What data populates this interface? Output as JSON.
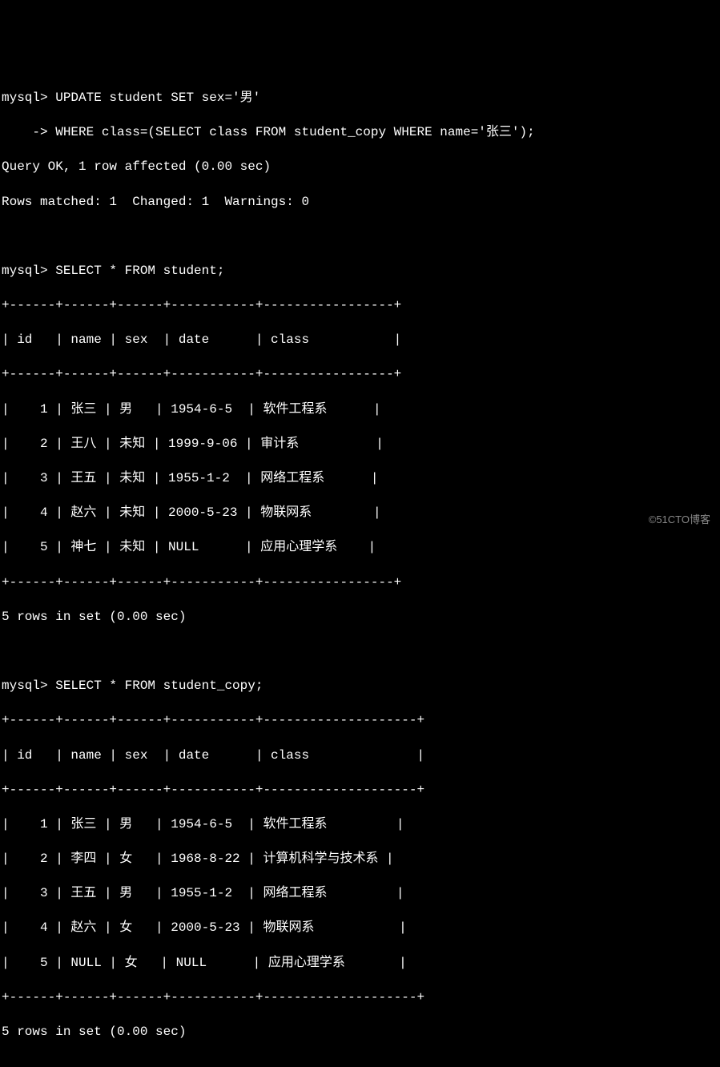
{
  "prompt": "mysql>",
  "continuation": "    ->",
  "commands": {
    "update_line1": " UPDATE student SET sex='男'",
    "update_line2": " WHERE class=(SELECT class FROM student_copy WHERE name='张三');",
    "select_student": " SELECT * FROM student;",
    "select_student_copy": " SELECT * FROM student_copy;"
  },
  "result": {
    "query_ok": "Query OK, 1 row affected (0.00 sec)",
    "rows_matched": "Rows matched: 1  Changed: 1  Warnings: 0",
    "rows_in_set": "5 rows in set (0.00 sec)"
  },
  "table1": {
    "border_top": "+------+------+------+-----------+-----------------+",
    "header": "| id   | name | sex  | date      | class           |",
    "border_mid": "+------+------+------+-----------+-----------------+",
    "rows": [
      "|    1 | 张三 | 男   | 1954-6-5  | 软件工程系      |",
      "|    2 | 王八 | 未知 | 1999-9-06 | 审计系          |",
      "|    3 | 王五 | 未知 | 1955-1-2  | 网络工程系      |",
      "|    4 | 赵六 | 未知 | 2000-5-23 | 物联网系        |",
      "|    5 | 神七 | 未知 | NULL      | 应用心理学系    |"
    ],
    "border_bot": "+------+------+------+-----------+-----------------+"
  },
  "table2": {
    "border_top": "+------+------+------+-----------+--------------------+",
    "header": "| id   | name | sex  | date      | class              |",
    "border_mid": "+------+------+------+-----------+--------------------+",
    "rows": [
      "|    1 | 张三 | 男   | 1954-6-5  | 软件工程系         |",
      "|    2 | 李四 | 女   | 1968-8-22 | 计算机科学与技术系 |",
      "|    3 | 王五 | 男   | 1955-1-2  | 网络工程系         |",
      "|    4 | 赵六 | 女   | 2000-5-23 | 物联网系           |",
      "|    5 | NULL | 女   | NULL      | 应用心理学系       |"
    ],
    "border_bot": "+------+------+------+-----------+--------------------+"
  },
  "chart_data": {
    "type": "table",
    "tables": [
      {
        "name": "student",
        "columns": [
          "id",
          "name",
          "sex",
          "date",
          "class"
        ],
        "rows": [
          [
            1,
            "张三",
            "男",
            "1954-6-5",
            "软件工程系"
          ],
          [
            2,
            "王八",
            "未知",
            "1999-9-06",
            "审计系"
          ],
          [
            3,
            "王五",
            "未知",
            "1955-1-2",
            "网络工程系"
          ],
          [
            4,
            "赵六",
            "未知",
            "2000-5-23",
            "物联网系"
          ],
          [
            5,
            "神七",
            "未知",
            "NULL",
            "应用心理学系"
          ]
        ]
      },
      {
        "name": "student_copy",
        "columns": [
          "id",
          "name",
          "sex",
          "date",
          "class"
        ],
        "rows": [
          [
            1,
            "张三",
            "男",
            "1954-6-5",
            "软件工程系"
          ],
          [
            2,
            "李四",
            "女",
            "1968-8-22",
            "计算机科学与技术系"
          ],
          [
            3,
            "王五",
            "男",
            "1955-1-2",
            "网络工程系"
          ],
          [
            4,
            "赵六",
            "女",
            "2000-5-23",
            "物联网系"
          ],
          [
            5,
            "NULL",
            "女",
            "NULL",
            "应用心理学系"
          ]
        ]
      }
    ]
  },
  "watermark": "©51CTO博客"
}
